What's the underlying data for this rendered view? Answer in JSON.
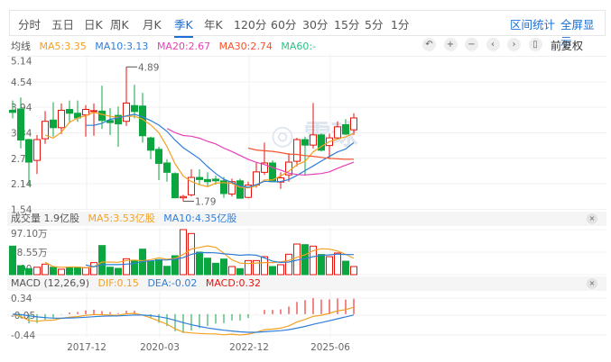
{
  "tabs": [
    {
      "label": "分时"
    },
    {
      "label": "五日"
    },
    {
      "label": "日K"
    },
    {
      "label": "周K"
    },
    {
      "label": "月K"
    },
    {
      "label": "季K",
      "active": true
    },
    {
      "label": "年K"
    },
    {
      "label": "120分"
    },
    {
      "label": "60分"
    },
    {
      "label": "30分"
    },
    {
      "label": "15分"
    },
    {
      "label": "5分"
    },
    {
      "label": "1分"
    }
  ],
  "actions": {
    "range_stats": "区间统计",
    "fullscreen": "全屏显示"
  },
  "legend": {
    "title": "均线",
    "ma5": "MA5:3.35",
    "ma10": "MA10:3.13",
    "ma20": "MA20:2.67",
    "ma30": "MA30:2.74",
    "ma60": "MA60:-"
  },
  "tools": [
    {
      "icon": "undo-icon",
      "glyph": "↶"
    },
    {
      "icon": "zoom-in-icon",
      "glyph": "+"
    },
    {
      "icon": "zoom-out-icon",
      "glyph": "−"
    },
    {
      "icon": "chevron-left-icon",
      "glyph": "‹"
    },
    {
      "icon": "chevron-right-icon",
      "glyph": "›"
    },
    {
      "icon": "candle-style-icon",
      "glyph": "▯"
    }
  ],
  "adjust": "前复权",
  "colors": {
    "up": "#e8120c",
    "down": "#0ca640",
    "ma5": "#f5a020",
    "ma10": "#2f7ed8",
    "ma20": "#e83fb5",
    "ma30": "#f5532d",
    "ma60": "#27c386",
    "accent": "#1b6fd6"
  },
  "volume": {
    "title": "成交量 1.9亿股",
    "ma5": "MA5:3.53亿股",
    "ma10": "MA10:4.35亿股",
    "close": "×"
  },
  "macd": {
    "title": "MACD (12,26,9)",
    "dif": "DIF:0.15",
    "dea": "DEA:-0.02",
    "macd": "MACD:0.32",
    "close": "×"
  },
  "chart_data": {
    "type": "candlestick",
    "price_axis": [
      "5.14",
      "4.54",
      "3.94",
      "3.34",
      "2.74",
      "2.14",
      "1.54"
    ],
    "ylim": [
      1.54,
      5.14
    ],
    "high_label": "4.89",
    "low_label": "1.79",
    "x_labels": [
      "2017-12",
      "2020-03",
      "2022-12",
      "2025-06"
    ],
    "candles": [
      [
        3.87,
        3.82,
        4.1,
        3.68
      ],
      [
        3.9,
        3.17,
        4.17,
        2.97
      ],
      [
        3.18,
        2.65,
        3.2,
        2.09
      ],
      [
        2.69,
        3.18,
        3.29,
        2.37
      ],
      [
        3.2,
        3.61,
        3.85,
        3.08
      ],
      [
        3.64,
        3.46,
        4.06,
        3.25
      ],
      [
        3.46,
        3.87,
        4.03,
        3.31
      ],
      [
        3.89,
        3.8,
        4.1,
        3.57
      ],
      [
        3.8,
        3.69,
        4.1,
        3.6
      ],
      [
        3.76,
        3.89,
        3.99,
        3.25
      ],
      [
        3.85,
        3.86,
        4.03,
        3.27
      ],
      [
        3.85,
        3.63,
        4.45,
        3.43
      ],
      [
        3.63,
        3.58,
        3.92,
        3.29
      ],
      [
        3.75,
        3.55,
        3.96,
        3.01
      ],
      [
        3.61,
        4.04,
        4.89,
        3.5
      ],
      [
        3.98,
        3.84,
        4.47,
        3.68
      ],
      [
        3.97,
        3.27,
        4.28,
        3.11
      ],
      [
        3.22,
        2.93,
        3.25,
        2.72
      ],
      [
        2.95,
        2.62,
        3.01,
        2.23
      ],
      [
        2.63,
        2.41,
        2.72,
        2.19
      ],
      [
        2.38,
        1.81,
        2.41,
        1.81
      ],
      [
        1.81,
        1.84,
        1.88,
        1.73
      ],
      [
        1.88,
        2.29,
        2.48,
        1.84
      ],
      [
        2.29,
        2.24,
        2.48,
        2.12
      ],
      [
        2.24,
        2.19,
        2.41,
        2.09
      ],
      [
        2.25,
        2.21,
        2.33,
        2.12
      ],
      [
        2.21,
        1.91,
        2.3,
        1.81
      ],
      [
        1.9,
        2.19,
        2.26,
        1.84
      ],
      [
        2.21,
        1.8,
        2.26,
        1.79
      ],
      [
        1.82,
        2.11,
        2.19,
        1.8
      ],
      [
        2.11,
        2.42,
        2.63,
        2.05
      ],
      [
        2.41,
        2.63,
        3.11,
        2.35
      ],
      [
        2.63,
        2.19,
        2.69,
        2.18
      ],
      [
        2.18,
        2.28,
        2.41,
        2.02
      ],
      [
        2.35,
        2.65,
        2.86,
        2.19
      ],
      [
        2.67,
        3.18,
        3.22,
        2.55
      ],
      [
        3.18,
        3.05,
        3.25,
        2.33
      ],
      [
        3.05,
        3.29,
        4.04,
        2.97
      ],
      [
        3.29,
        2.93,
        3.32,
        2.9
      ],
      [
        3.04,
        3.22,
        3.32,
        2.72
      ],
      [
        3.22,
        3.48,
        3.61,
        3.2
      ],
      [
        3.53,
        3.31,
        3.66,
        3.29
      ],
      [
        3.41,
        3.69,
        3.8,
        3.29
      ]
    ],
    "volume_axis": [
      "97.10万",
      "48.55万",
      "0.00"
    ],
    "volume_max": 97.1,
    "volume": [
      61.5,
      19.4,
      13,
      16,
      22.7,
      16,
      11.7,
      16,
      16,
      14.9,
      25.9,
      62.8,
      16,
      13.6,
      34.3,
      30.4,
      55,
      29,
      32.4,
      18,
      40.8,
      97.1,
      88.7,
      48.6,
      35.6,
      24.6,
      33.7,
      17.5,
      13,
      30.4,
      30.4,
      38.8,
      17.5,
      21.4,
      44,
      66,
      64.7,
      61.5,
      43.4,
      38.8,
      46.6,
      29,
      17.5
    ],
    "macd_axis": [
      "0.34",
      "-0.05",
      "-0.44"
    ]
  }
}
